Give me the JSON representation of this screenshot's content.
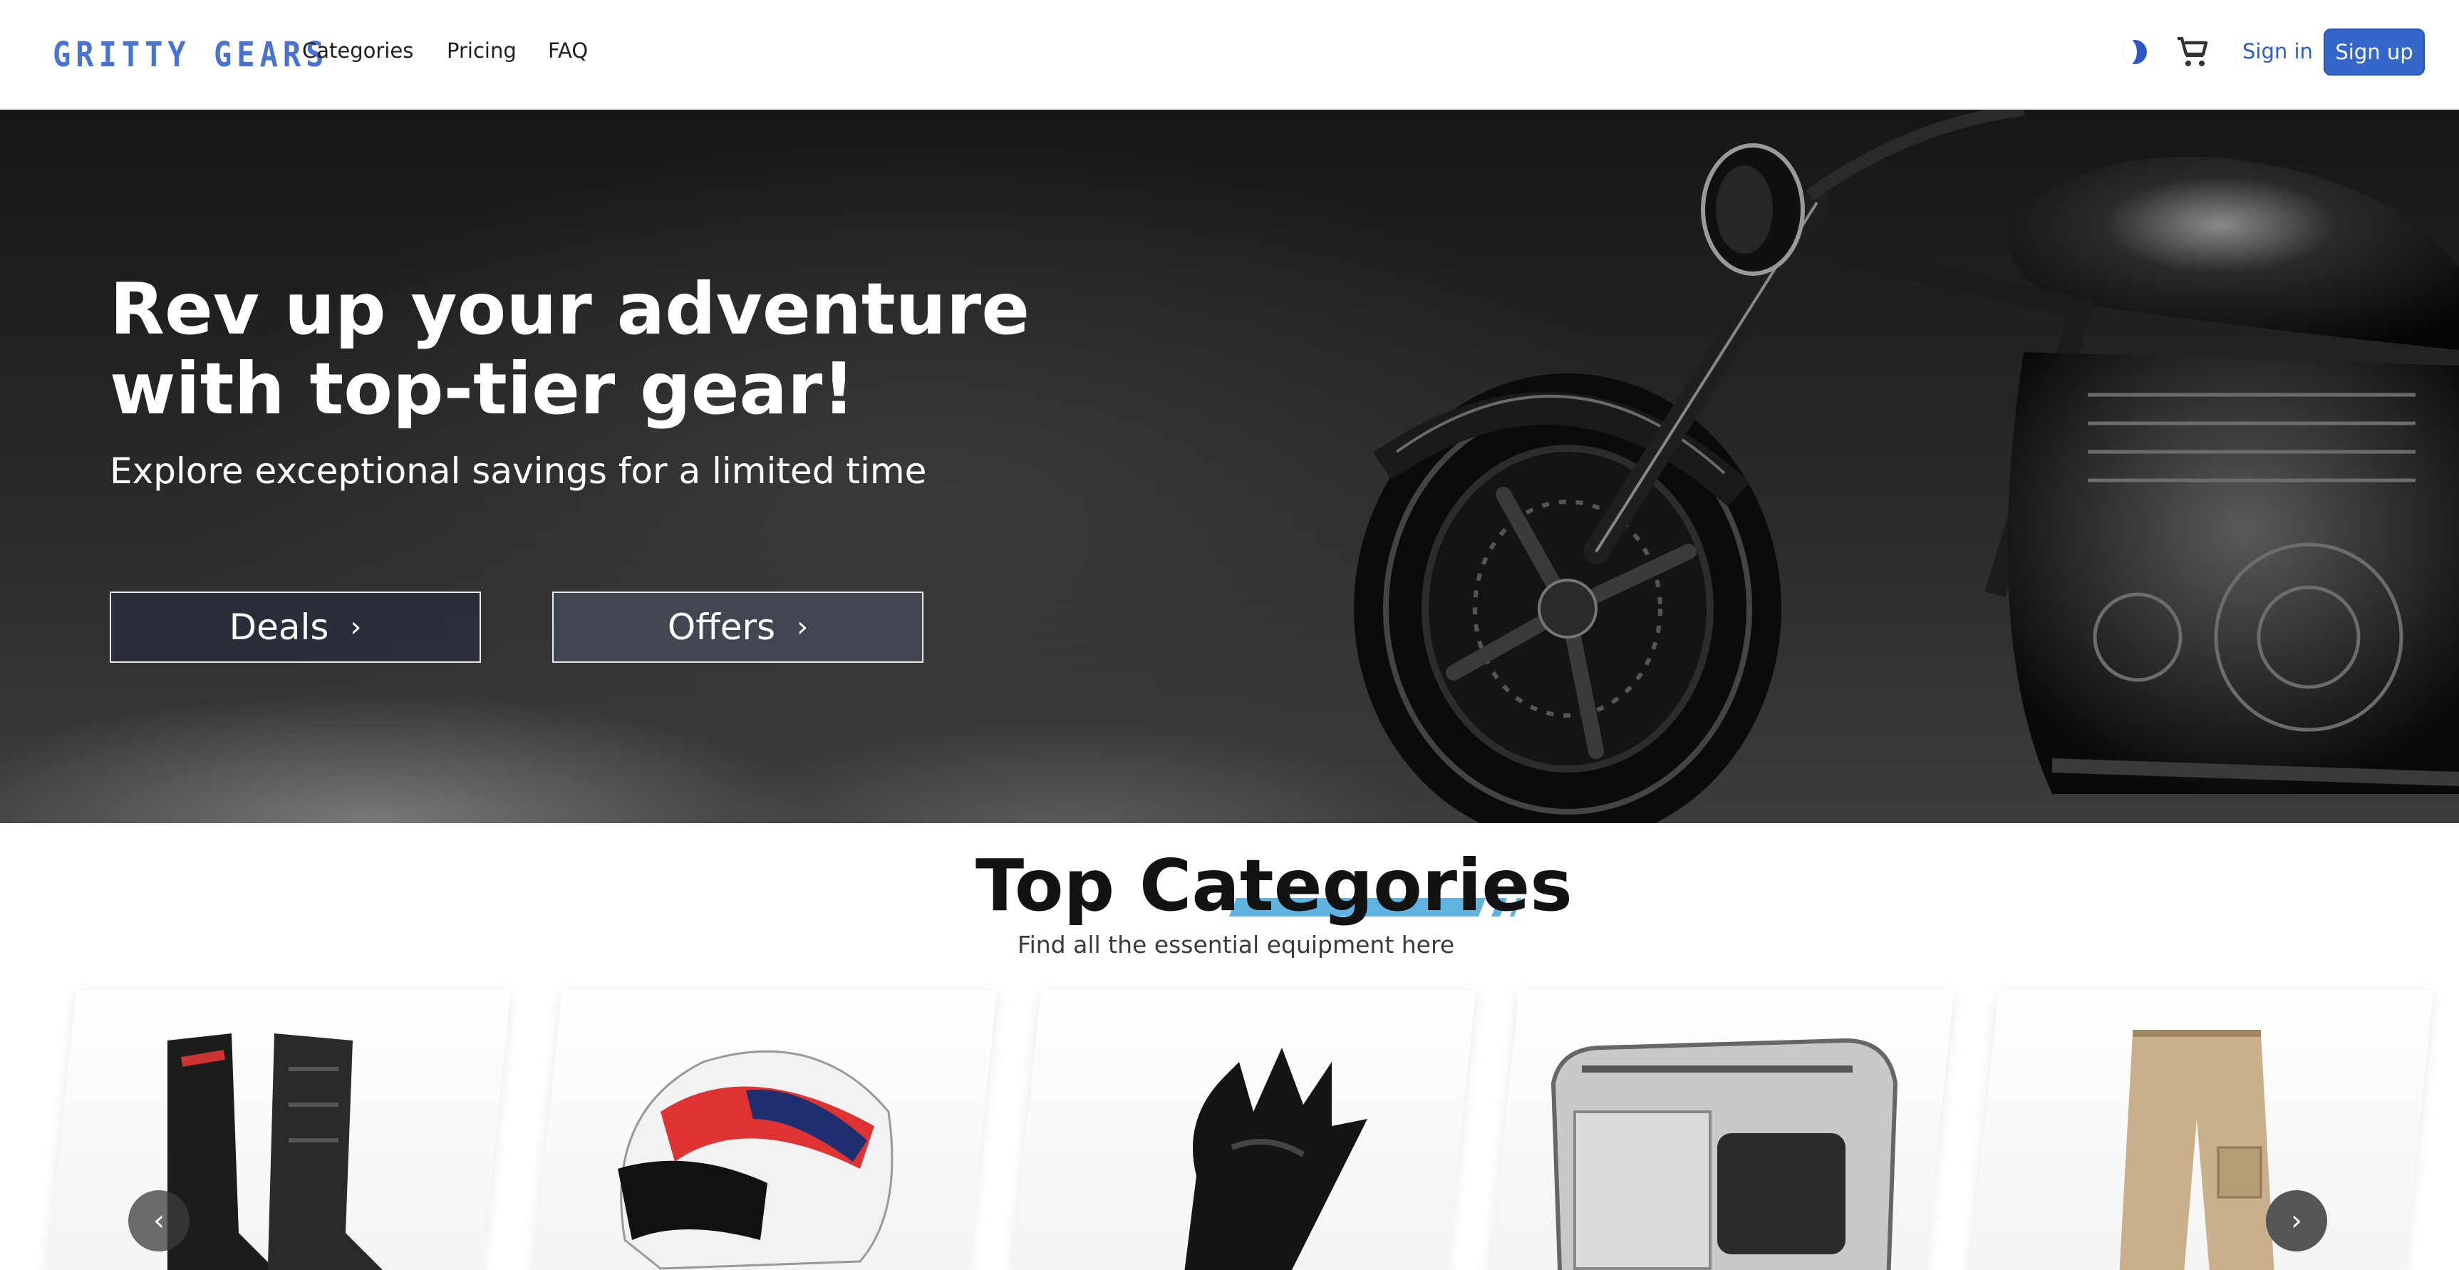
{
  "brand": {
    "name": "GRITTY GEARS",
    "accent": "#4a72d0"
  },
  "nav": {
    "links": [
      "Categories",
      "Pricing",
      "FAQ"
    ]
  },
  "header": {
    "sign_in": "Sign in",
    "sign_up": "Sign up",
    "theme_icon": "moon-icon",
    "cart_icon": "cart-icon"
  },
  "hero": {
    "title": "Rev up your adventure with top-tier gear!",
    "subtitle": "Explore exceptional savings for a limited time",
    "buttons": [
      "Deals",
      "Offers"
    ]
  },
  "categories": {
    "title": "Top Categories",
    "subtitle": "Find all the essential equipment here",
    "items": [
      "boots",
      "helmet",
      "gloves",
      "top-case",
      "pants"
    ],
    "underline_color": "#5fb3e0"
  },
  "carousel": {
    "prev_icon": "chevron-left-icon",
    "next_icon": "chevron-right-icon"
  }
}
